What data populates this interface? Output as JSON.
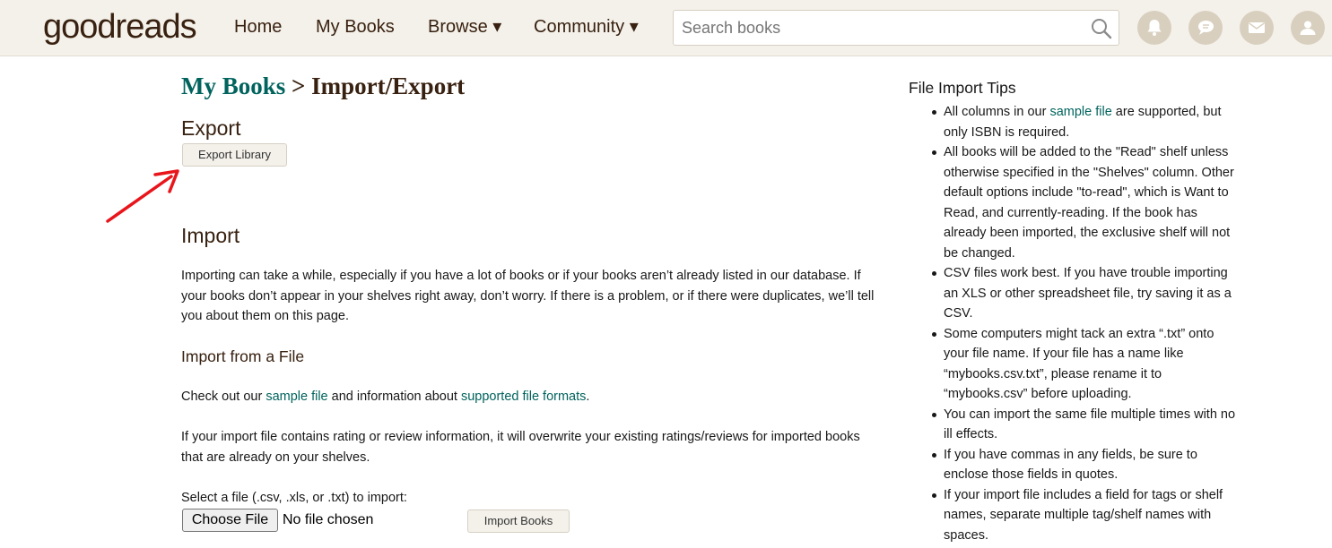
{
  "header": {
    "logo_light": "good",
    "logo_bold": "reads",
    "nav": {
      "home": "Home",
      "my_books": "My Books",
      "browse": "Browse ▾",
      "community": "Community ▾"
    },
    "search": {
      "placeholder": "Search books",
      "value": ""
    },
    "icons": [
      "bell-icon",
      "discussion-icon",
      "mail-icon",
      "profile-icon"
    ]
  },
  "breadcrumb": {
    "link": "My Books",
    "separator": " > ",
    "current": "Import/Export"
  },
  "export": {
    "heading": "Export",
    "button": "Export Library"
  },
  "import": {
    "heading": "Import",
    "intro": "Importing can take a while, especially if you have a lot of books or if your books aren’t already listed in our database. If your books don’t appear in your shelves right away, don’t worry. If there is a problem, or if there were duplicates, we’ll tell you about them on this page.",
    "from_file_heading": "Import from a File",
    "checkout_prefix": "Check out our ",
    "sample_file_link": "sample file",
    "checkout_middle": " and information about ",
    "formats_link": "supported file formats",
    "checkout_suffix": ".",
    "overwrite_note": "If your import file contains rating or review information, it will overwrite your existing ratings/reviews for imported books that are already on your shelves.",
    "select_label": "Select a file (.csv, .xls, or .txt) to import:",
    "choose_file": "Choose File",
    "no_file": "No file chosen",
    "import_button": "Import Books"
  },
  "tips": {
    "title": "File Import Tips",
    "tip1_prefix": "All columns in our ",
    "tip1_link": "sample file",
    "tip1_suffix": " are supported, but only ISBN is required.",
    "items": [
      "All books will be added to the \"Read\" shelf unless otherwise specified in the \"Shelves\" column. Other default options include \"to-read\", which is Want to Read, and currently-reading. If the book has already been imported, the exclusive shelf will not be changed.",
      "CSV files work best. If you have trouble importing an XLS or other spreadsheet file, try saving it as a CSV.",
      "Some computers might tack an extra “.txt” onto your file name. If your file has a name like “mybooks.csv.txt”, please rename it to “mybooks.csv” before uploading.",
      "You can import the same file multiple times with no ill effects.",
      "If you have commas in any fields, be sure to enclose those fields in quotes.",
      "If your import file includes a field for tags or shelf names, separate multiple tag/shelf names with spaces."
    ]
  },
  "colors": {
    "brand_brown": "#382110",
    "link_green": "#00635d",
    "header_bg": "#f4f1ea",
    "arrow_red": "#e8151b"
  }
}
